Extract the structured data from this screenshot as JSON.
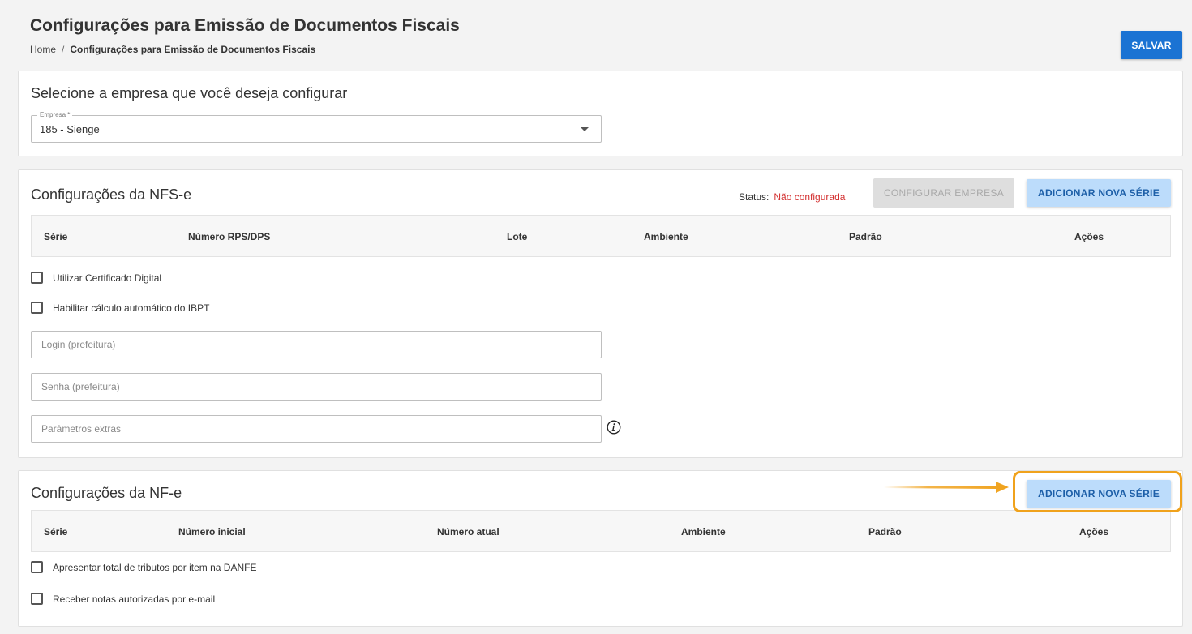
{
  "header": {
    "title": "Configurações para Emissão de Documentos Fiscais",
    "breadcrumb": {
      "home": "Home",
      "separator": "/",
      "current": "Configurações para Emissão de Documentos Fiscais"
    },
    "save_label": "SALVAR"
  },
  "company": {
    "title": "Selecione a empresa que você deseja configurar",
    "field_label": "Empresa *",
    "selected": "185 - Sienge"
  },
  "nfse": {
    "title": "Configurações da NFS-e",
    "status_label": "Status:",
    "status_value": "Não configurada",
    "configure_label": "CONFIGURAR EMPRESA",
    "add_series_label": "ADICIONAR NOVA SÉRIE",
    "columns": [
      "Série",
      "Número RPS/DPS",
      "Lote",
      "Ambiente",
      "Padrão",
      "Ações"
    ],
    "checkboxes": [
      "Utilizar Certificado Digital",
      "Habilitar cálculo automático do IBPT"
    ],
    "inputs": {
      "login_placeholder": "Login (prefeitura)",
      "password_placeholder": "Senha (prefeitura)",
      "extra_placeholder": "Parâmetros extras"
    }
  },
  "nfe": {
    "title": "Configurações da NF-e",
    "add_series_label": "ADICIONAR NOVA SÉRIE",
    "columns": [
      "Série",
      "Número inicial",
      "Número atual",
      "Ambiente",
      "Padrão",
      "Ações"
    ],
    "checkboxes": [
      "Apresentar total de tributos por item na DANFE",
      "Receber notas autorizadas por e-mail"
    ]
  },
  "colors": {
    "primary": "#1b73d3",
    "light_button": "#bcdcfb",
    "status_error": "#d32f2f",
    "highlight": "#f0a21c"
  },
  "icons": {
    "select_caret": "caret-down-icon",
    "info": "info-icon",
    "annotation_arrow": "arrow-right-icon"
  }
}
